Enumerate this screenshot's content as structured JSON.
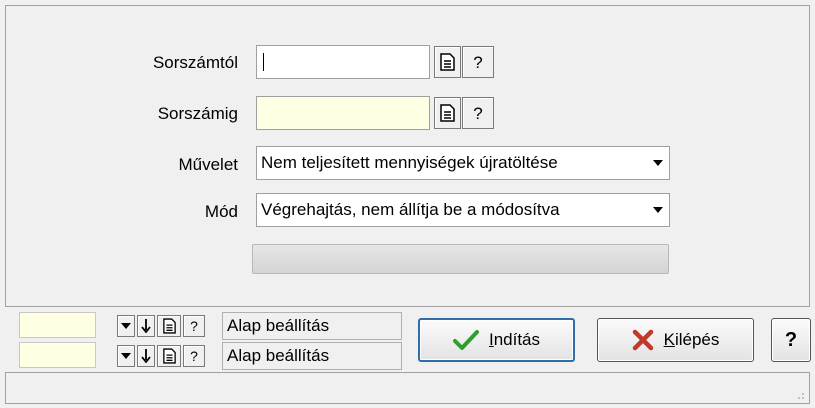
{
  "form": {
    "from_label": "Sorszámtól",
    "from_value": "",
    "to_label": "Sorszámig",
    "to_value": "",
    "op_label": "Művelet",
    "op_value": "Nem teljesített mennyiségek újratöltése",
    "mode_label": "Mód",
    "mode_value": "Végrehajtás, nem állítja be a módosítva",
    "help_glyph": "?",
    "progress": 0
  },
  "presets": [
    {
      "label": "Alap beállítás"
    },
    {
      "label": "Alap beállítás"
    }
  ],
  "buttons": {
    "start_label": "Indítás",
    "exit_label": "Kilépés",
    "help_label": "?"
  },
  "colors": {
    "yellow_field": "#ffffe4",
    "focus_border": "#2f6ea6",
    "check_green": "#2e9e2e",
    "exit_red": "#c0392b"
  },
  "icons": [
    "document-icon",
    "help-icon",
    "dropdown-icon",
    "down-arrow-icon",
    "checkmark-icon",
    "x-icon",
    "resize-grip-icon"
  ]
}
